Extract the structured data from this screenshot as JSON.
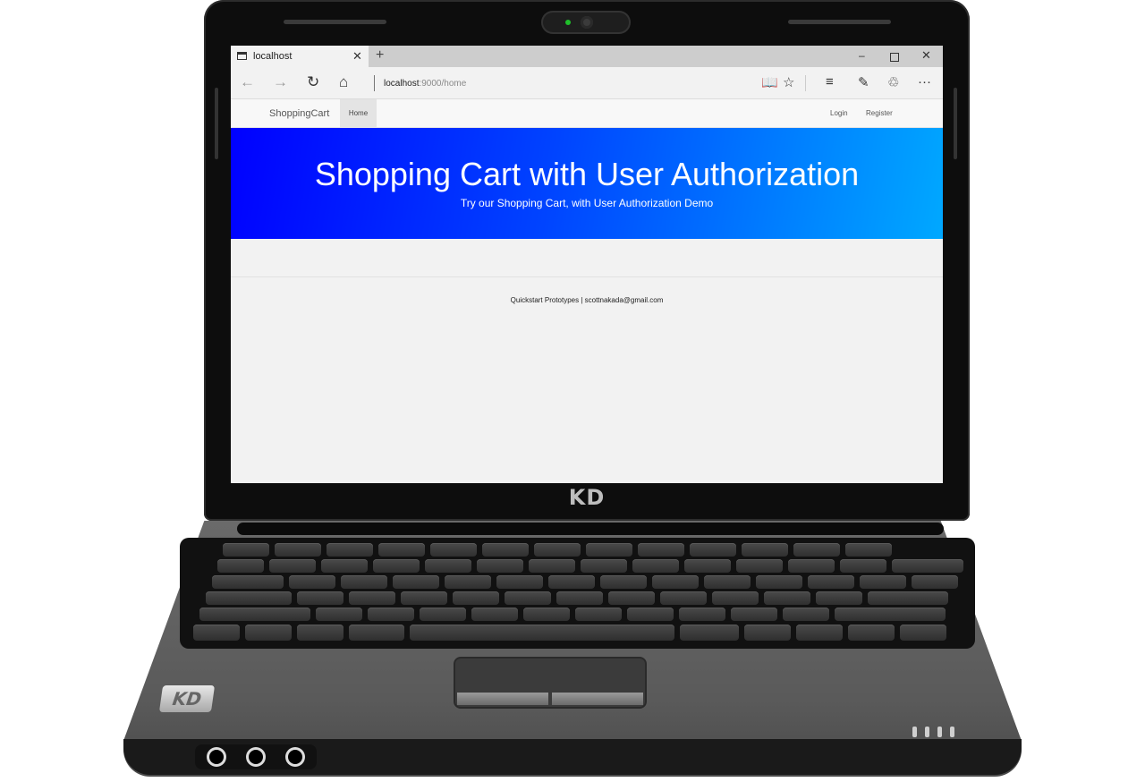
{
  "browser": {
    "tab_title": "localhost",
    "tab_close": "✕",
    "new_tab": "+",
    "url_host": "localhost",
    "url_path": ":9000/home",
    "window_controls": {
      "minimize": "–",
      "close": "✕"
    },
    "nav_icons": {
      "back": "←",
      "forward": "→",
      "refresh": "↻",
      "home": "⌂"
    },
    "toolbar_icons": {
      "reading_view": "📖",
      "favorite": "☆",
      "hub": "≡",
      "web_note": "✎",
      "share": "♲",
      "more": "···"
    }
  },
  "site": {
    "brand": "ShoppingCart",
    "nav": {
      "home": "Home",
      "login": "Login",
      "register": "Register"
    },
    "hero": {
      "title": "Shopping Cart with User Authorization",
      "subtitle": "Try our Shopping Cart, with User Authorization Demo"
    },
    "footer": "Quickstart Prototypes | scottnakada@gmail.com"
  },
  "laptop": {
    "lid_logo": "KD",
    "badge_logo": "KD"
  },
  "colors": {
    "hero_start": "#0000ff",
    "hero_end": "#00a8ff",
    "webcam_led": "#1fbf2a"
  }
}
